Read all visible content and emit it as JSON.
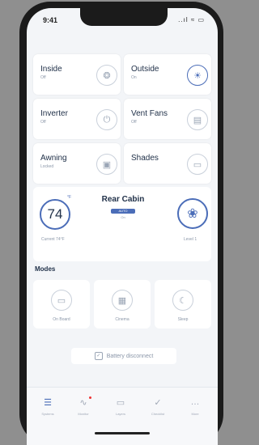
{
  "status": {
    "time": "9:41",
    "icons": "..ıl ≈ ▭"
  },
  "tiles": [
    {
      "title": "Inside",
      "sub": "Off",
      "icon": "bulb-icon",
      "glyph": "❂",
      "active": false
    },
    {
      "title": "Outside",
      "sub": "On",
      "icon": "sun-icon",
      "glyph": "☀",
      "active": true
    },
    {
      "title": "Inverter",
      "sub": "Off",
      "icon": "power-icon",
      "glyph": "⏻",
      "active": false
    },
    {
      "title": "Vent Fans",
      "sub": "Off",
      "icon": "vent-icon",
      "glyph": "▤",
      "active": false
    },
    {
      "title": "Awning",
      "sub": "Locked",
      "icon": "awning-icon",
      "glyph": "▣",
      "active": false
    },
    {
      "title": "Shades",
      "sub": "",
      "icon": "shades-icon",
      "glyph": "▭",
      "active": false
    }
  ],
  "cabin": {
    "temperature": "74",
    "temp_unit": "°F",
    "temp_label": "Current 74°F",
    "title": "Rear Cabin",
    "mode_badge": "AUTO",
    "mode_sub": "On",
    "fan_label": "Level 1",
    "fan_icon": "fan-icon",
    "accent": "#4b6db8"
  },
  "modes": {
    "title": "Modes",
    "items": [
      {
        "label": "On Board",
        "icon": "on-board-icon",
        "glyph": "▭"
      },
      {
        "label": "Cinema",
        "icon": "cinema-icon",
        "glyph": "▦"
      },
      {
        "label": "Sleep",
        "icon": "sleep-icon",
        "glyph": "☾"
      }
    ]
  },
  "battery": {
    "label": "Battery disconnect",
    "check": "✓"
  },
  "tabs": [
    {
      "label": "Systems",
      "icon": "systems-icon",
      "glyph": "☰",
      "active": true
    },
    {
      "label": "Monitor",
      "icon": "monitor-icon",
      "glyph": "∿",
      "active": false
    },
    {
      "label": "Layers",
      "icon": "layers-icon",
      "glyph": "▭",
      "active": false
    },
    {
      "label": "Checklist",
      "icon": "checklist-icon",
      "glyph": "✓",
      "active": false
    },
    {
      "label": "More",
      "icon": "more-icon",
      "glyph": "…",
      "active": false
    }
  ]
}
